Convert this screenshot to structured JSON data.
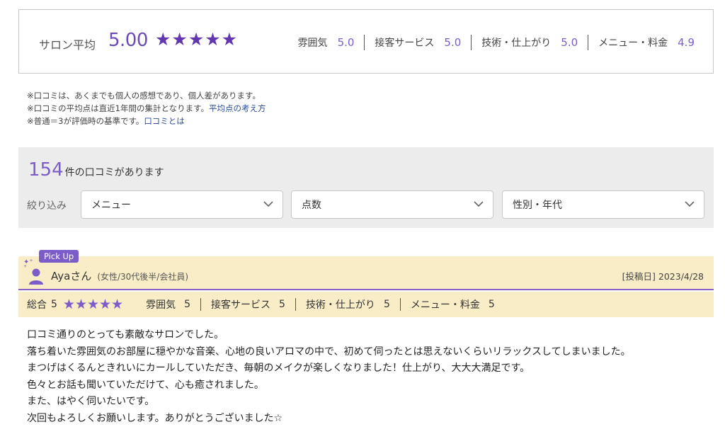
{
  "summary": {
    "label": "サロン平均",
    "value": "5.00",
    "stars": "★★★★★",
    "categories": [
      {
        "label": "雰囲気",
        "score": "5.0"
      },
      {
        "label": "接客サービス",
        "score": "5.0"
      },
      {
        "label": "技術・仕上がり",
        "score": "5.0"
      },
      {
        "label": "メニュー・料金",
        "score": "4.9"
      }
    ]
  },
  "notes": {
    "line1": "※口コミは、あくまでも個人の感想であり、個人差があります。",
    "line2": "※口コミの平均点は直近1年間の集計となります。",
    "line2_link": "平均点の考え方",
    "line3": "※普通＝3が評価時の基準です。",
    "line3_link": "口コミとは"
  },
  "filter": {
    "count": "154",
    "count_text": "件の口コミがあります",
    "label": "絞り込み",
    "selects": [
      {
        "value": "メニュー"
      },
      {
        "value": "点数"
      },
      {
        "value": "性別・年代"
      }
    ]
  },
  "review": {
    "pickup": "Pick Up",
    "name": "Ayaさん",
    "meta": "(女性/30代後半/会社員)",
    "date": "[投稿日] 2023/4/28",
    "overall_label": "総合",
    "overall_score": "5",
    "stars": "★★★★★",
    "ratings": [
      {
        "label": "雰囲気",
        "score": "5"
      },
      {
        "label": "接客サービス",
        "score": "5"
      },
      {
        "label": "技術・仕上がり",
        "score": "5"
      },
      {
        "label": "メニュー・料金",
        "score": "5"
      }
    ],
    "body": [
      "口コミ通りのとっても素敵なサロンでした。",
      "落ち着いた雰囲気のお部屋に穏やかな音楽、心地の良いアロマの中で、初めて伺ったとは思えないくらいリラックスしてしまいました。",
      "まつげはくるんときれいにカールしていただき、毎朝のメイクが楽しくなりました！仕上がり、大大大満足です。",
      "色々とお話も聞いていただけて、心も癒されました。",
      "また、はやく伺いたいです。",
      "次回もよろしくお願いします。ありがとうございました☆"
    ]
  },
  "colors": {
    "accent": "#7b5cc8",
    "star": "#6237b0",
    "review_bg": "#f9edc8",
    "panel_bg": "#ececec"
  }
}
